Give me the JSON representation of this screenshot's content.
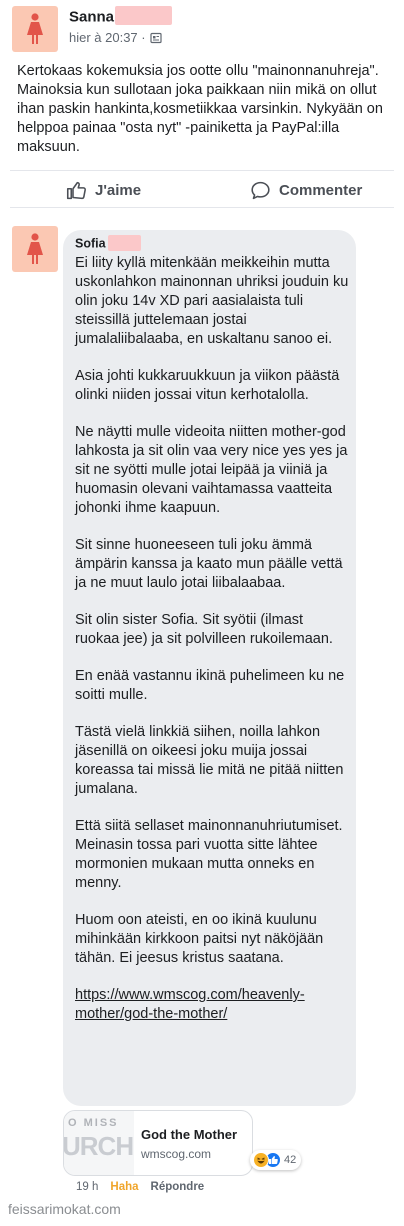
{
  "post": {
    "author": "Sanna",
    "time": "hier à 20:37 ·",
    "text": "Kertokaas kokemuksia jos ootte ollu \"mainonnanuhreja\". Mainoksia kun sullotaan joka paikkaan niin mikä on ollut ihan paskin hankinta,kosmetiikkaa varsinkin. Nykyään on helppoa painaa \"osta nyt\" -painiketta ja PayPal:illa maksuun."
  },
  "actions": {
    "like_label": "J'aime",
    "comment_label": "Commenter"
  },
  "comment": {
    "author": "Sofia",
    "paragraphs": [
      "Ei liity kyllä mitenkään meikkeihin mutta uskonlahkon mainonnan uhriksi jouduin ku olin joku 14v XD pari aasialaista tuli steissillä juttelemaan jostai jumalaliibalaaba, en uskaltanu sanoo ei.",
      "Asia johti kukkaruukkuun ja viikon päästä olinki niiden jossai vitun kerhotalolla.",
      "Ne näytti mulle videoita niitten mother-god lahkosta ja sit olin vaa very nice yes yes ja sit ne syötti mulle jotai leipää ja viiniä ja huomasin olevani vaihtamassa vaatteita johonki ihme kaapuun.",
      "Sit sinne huoneeseen tuli joku ämmä ämpärin kanssa ja kaato mun päälle vettä ja ne muut laulo jotai liibalaabaa.",
      "Sit olin sister Sofia. Sit syötii (ilmast ruokaa jee) ja sit polvilleen rukoilemaan.",
      "En enää vastannu ikinä puhelimeen ku ne soitti mulle.",
      "Tästä vielä linkkiä siihen, noilla lahkon jäsenillä on oikeesi joku muija jossai koreassa tai missä lie mitä ne pitää niitten jumalana.",
      "Että siitä sellaset mainonnanuhriutumiset. Meinasin tossa pari vuotta sitte lähtee mormonien mukaan mutta onneks en menny.",
      "Huom oon ateisti, en oo ikinä kuulunu mihinkään kirkkoon paitsi nyt näköjään tähän. Ei jeesus kristus saatana."
    ],
    "link_text": "https://www.wmscog.com/heavenly-mother/god-the-mother/",
    "link_card": {
      "thumb_top": "O MISS",
      "thumb_big": "URCH",
      "title": "God the Mother",
      "domain": "wmscog.com"
    },
    "reaction_count": "42",
    "footer": {
      "time": "19 h",
      "haha": "Haha",
      "reply": "Répondre"
    }
  },
  "watermark": "feissarimokat.com",
  "colors": {
    "avatar_bg": "#fbc8b3",
    "person_icon": "#e2554a",
    "bubble_bg": "#ebedf0",
    "haha": "#f0a52a",
    "like_blue": "#1877f2"
  }
}
